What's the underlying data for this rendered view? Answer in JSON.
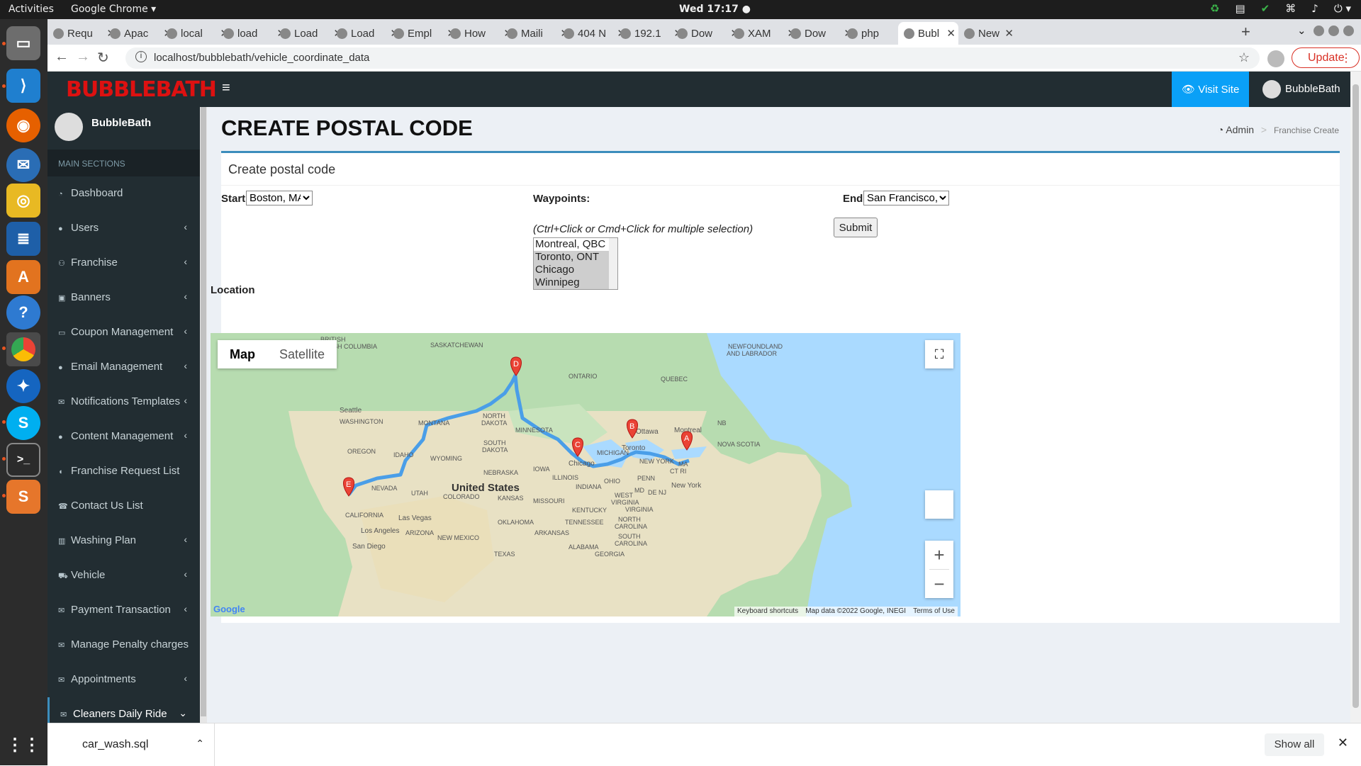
{
  "os": {
    "activities": "Activities",
    "app_name": "Google Chrome ▾",
    "clock": "Wed 17:17 ●"
  },
  "tabs": [
    {
      "label": "Requ"
    },
    {
      "label": "Apac"
    },
    {
      "label": "local"
    },
    {
      "label": "load"
    },
    {
      "label": "Load"
    },
    {
      "label": "Load"
    },
    {
      "label": "Empl"
    },
    {
      "label": "How"
    },
    {
      "label": "Maili"
    },
    {
      "label": "404 N"
    },
    {
      "label": "192.1"
    },
    {
      "label": "Dow"
    },
    {
      "label": "XAM"
    },
    {
      "label": "Dow"
    },
    {
      "label": "php"
    },
    {
      "label": "Bubl"
    },
    {
      "label": "New"
    }
  ],
  "browser": {
    "url": "localhost/bubblebath/vehicle_coordinate_data",
    "update_label": "Update"
  },
  "header": {
    "logo": "BUBBLEBATH",
    "visit_site": "Visit Site",
    "user_name": "BubbleBath"
  },
  "sidebar": {
    "user_name": "BubbleBath",
    "section": "MAIN SECTIONS",
    "items": [
      {
        "label": "Dashboard",
        "icon": "dashboard-icon",
        "chevron": ""
      },
      {
        "label": "Users",
        "icon": "user-icon",
        "chevron": "‹"
      },
      {
        "label": "Franchise",
        "icon": "users-icon",
        "chevron": "‹"
      },
      {
        "label": "Banners",
        "icon": "image-icon",
        "chevron": "‹"
      },
      {
        "label": "Coupon Management",
        "icon": "coupon-icon",
        "chevron": "‹"
      },
      {
        "label": "Email Management",
        "icon": "user-icon",
        "chevron": "‹"
      },
      {
        "label": "Notifications Templates",
        "icon": "envelope-icon",
        "chevron": "‹"
      },
      {
        "label": "Content Management",
        "icon": "user-icon",
        "chevron": "‹"
      },
      {
        "label": "Franchise Request List",
        "icon": "comment-icon",
        "chevron": ""
      },
      {
        "label": "Contact Us List",
        "icon": "phone-icon",
        "chevron": ""
      },
      {
        "label": "Washing Plan",
        "icon": "chart-icon",
        "chevron": "‹"
      },
      {
        "label": "Vehicle",
        "icon": "car-icon",
        "chevron": "‹"
      },
      {
        "label": "Payment Transaction",
        "icon": "envelope-icon",
        "chevron": "‹"
      },
      {
        "label": "Manage Penalty charges",
        "icon": "envelope-icon",
        "chevron": ""
      },
      {
        "label": "Appointments",
        "icon": "envelope-icon",
        "chevron": "‹"
      },
      {
        "label": "Cleaners Daily Ride",
        "icon": "envelope-icon",
        "chevron": "⌄"
      }
    ]
  },
  "page": {
    "title": "CREATE POSTAL CODE",
    "breadcrumb_home": "Admin",
    "breadcrumb_current": "Franchise Create",
    "box_title": "Create postal code"
  },
  "form": {
    "start_label": "Start:",
    "start_value": "Boston, MA",
    "waypoints_label": "Waypoints:",
    "waypoints_hint": "(Ctrl+Click or Cmd+Click for multiple selection)",
    "waypoints": [
      {
        "label": "Montreal, QBC",
        "selected": false
      },
      {
        "label": "Toronto, ONT",
        "selected": true
      },
      {
        "label": "Chicago",
        "selected": true
      },
      {
        "label": "Winnipeg",
        "selected": true
      }
    ],
    "end_label": "End:",
    "end_value": "San Francisco, CA",
    "submit_label": "Submit",
    "location_label": "Location"
  },
  "map": {
    "type_map": "Map",
    "type_satellite": "Satellite",
    "markers": [
      "A",
      "B",
      "C",
      "D",
      "E"
    ],
    "labels": {
      "country": "United States",
      "bc": "BRITISH COLUMBIA",
      "sask": "SASKATCHEWAN",
      "ontario": "ONTARIO",
      "quebec": "QUEBEC",
      "nfl1": "NEWFOUNDLAND",
      "nfl2": "AND LABRADOR",
      "nb": "NB",
      "ns": "NOVA SCOTIA",
      "seattle": "Seattle",
      "washington": "WASHINGTON",
      "montana": "MONTANA",
      "nd1": "NORTH",
      "nd2": "DAKOTA",
      "minnesota": "MINNESOTA",
      "ottawa": "Ottawa",
      "montreal": "Montreal",
      "oregon": "OREGON",
      "idaho": "IDAHO",
      "wyoming": "WYOMING",
      "sd1": "SOUTH",
      "sd2": "DAKOTA",
      "michigan": "MICHIGAN",
      "toronto": "Toronto",
      "chicago": "Chicago",
      "iowa": "IOWA",
      "illinois": "ILLINOIS",
      "nebraska": "NEBRASKA",
      "ohio": "OHIO",
      "newyork_state": "NEW YORK",
      "penn": "PENN",
      "indiana": "INDIANA",
      "nevada": "NEVADA",
      "utah": "UTAH",
      "colorado": "COLORADO",
      "kansas": "KANSAS",
      "missouri": "MISSOURI",
      "newyork": "New York",
      "md": "MD",
      "denj": "DE NJ",
      "wv1": "WEST",
      "wv2": "VIRGINIA",
      "virginia": "VIRGINIA",
      "california": "CALIFORNIA",
      "lasvegas": "Las Vegas",
      "kentucky": "KENTUCKY",
      "losangeles": "Los Angeles",
      "arizona": "ARIZONA",
      "oklahoma": "OKLAHOMA",
      "tennessee": "TENNESSEE",
      "nc1": "NORTH",
      "nc2": "CAROLINA",
      "sc1": "SOUTH",
      "sc2": "CAROLINA",
      "sandiego": "San Diego",
      "newmexico": "NEW MEXICO",
      "arkansas": "ARKANSAS",
      "alabama": "ALABAMA",
      "georgia": "GEORGIA",
      "texas": "TEXAS",
      "ctri": "CT RI",
      "ma": "MA"
    },
    "attribution_shortcuts": "Keyboard shortcuts",
    "attribution_data": "Map data ©2022 Google, INEGI",
    "attribution_terms": "Terms of Use",
    "google_logo": "Google",
    "route_color": "#4a9ee8",
    "marker_color": "#ea4335"
  },
  "downloads": {
    "file_name": "car_wash.sql",
    "show_all": "Show all"
  }
}
